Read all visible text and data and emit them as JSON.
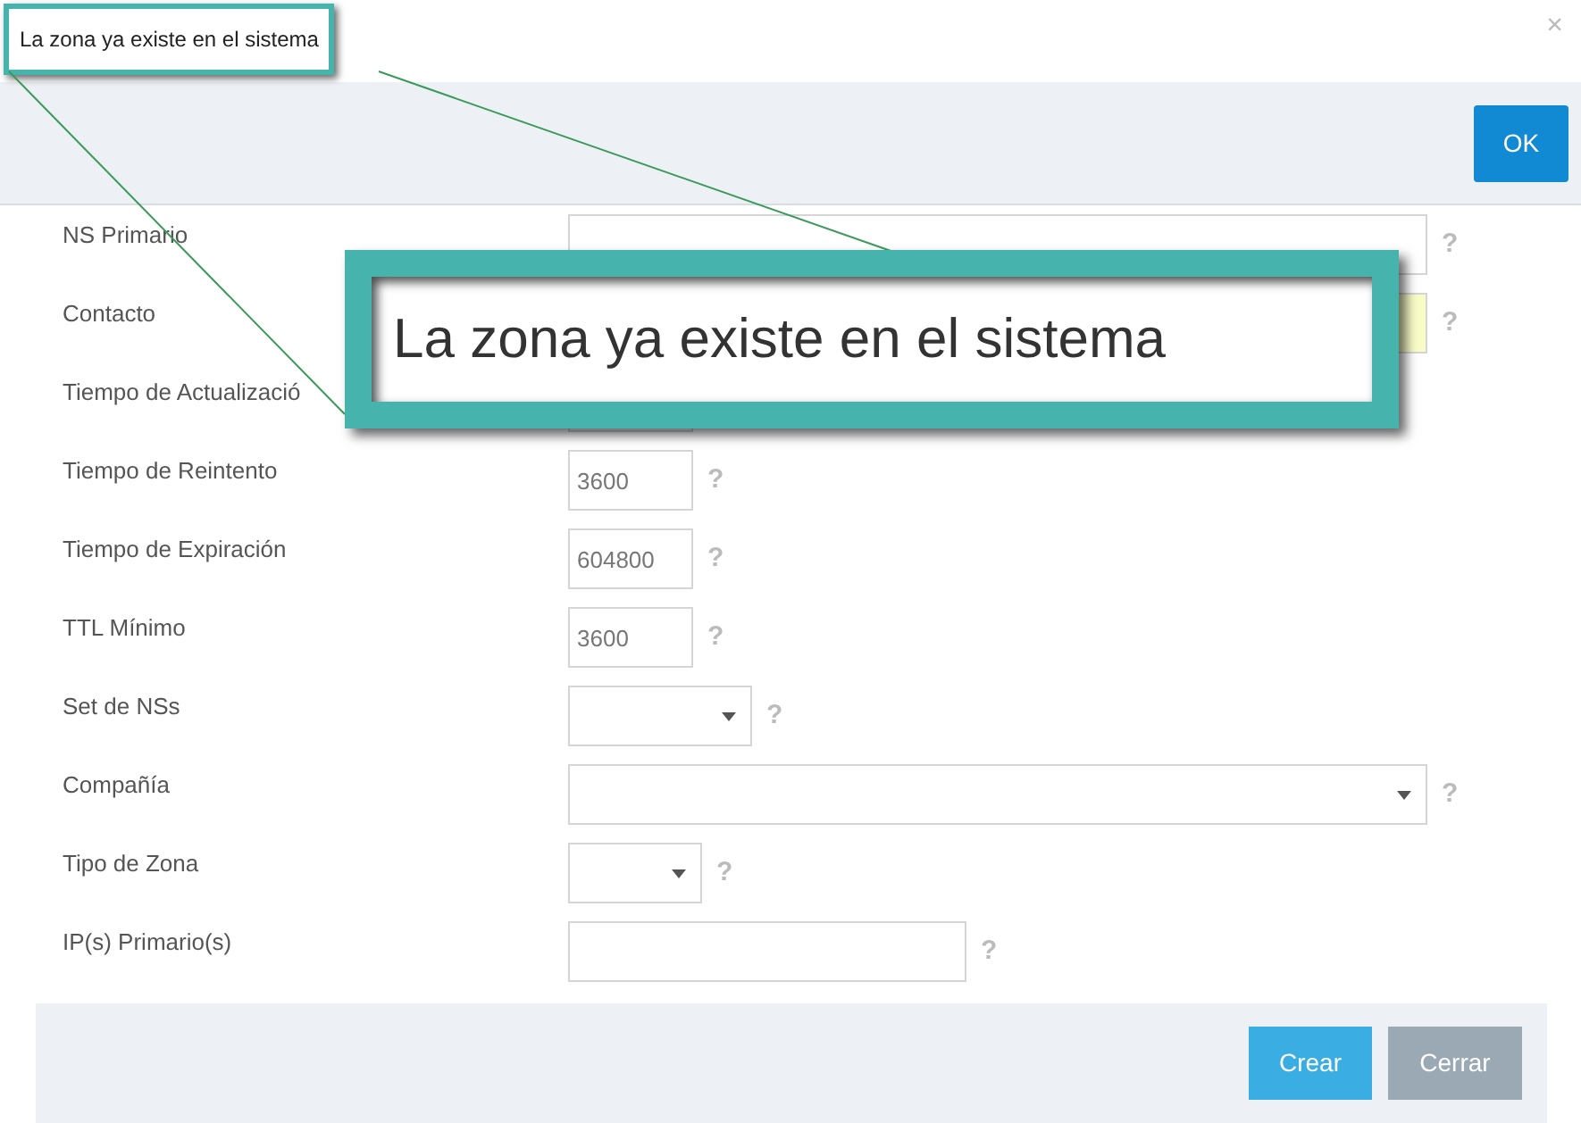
{
  "message_dialog": {
    "message": "La zona ya existe en el sistema",
    "close": "×",
    "button": "OK"
  },
  "callout": {
    "text": "La zona ya existe en el sistema"
  },
  "form": {
    "fields": [
      {
        "label": "NS Primario",
        "kind": "text",
        "help": "?",
        "autofilled": false
      },
      {
        "label": "Contacto",
        "kind": "text",
        "help": "?",
        "autofilled": true
      },
      {
        "label": "Tiempo de Actualizació",
        "kind": "text",
        "autofilled": false
      },
      {
        "label": "Tiempo de Reintento",
        "kind": "text",
        "value": "3600",
        "help": "?",
        "autofilled": false
      },
      {
        "label": "Tiempo de Expiración",
        "kind": "text",
        "value": "604800",
        "help": "?",
        "autofilled": false
      },
      {
        "label": "TTL Mínimo",
        "kind": "text",
        "value": "3600",
        "help": "?",
        "autofilled": false
      },
      {
        "label": "Set de NSs",
        "kind": "select",
        "help": "?",
        "autofilled": false
      },
      {
        "label": "Compañía",
        "kind": "combo",
        "help": "?",
        "autofilled": false
      },
      {
        "label": "Tipo de Zona",
        "kind": "select",
        "help": "?",
        "autofilled": false
      },
      {
        "label": "IP(s) Primario(s)",
        "kind": "text",
        "help": "?",
        "autofilled": false
      }
    ],
    "buttons": [
      {
        "label": "Crear",
        "disabled": false
      },
      {
        "label": "Cerrar",
        "disabled": true
      }
    ]
  }
}
